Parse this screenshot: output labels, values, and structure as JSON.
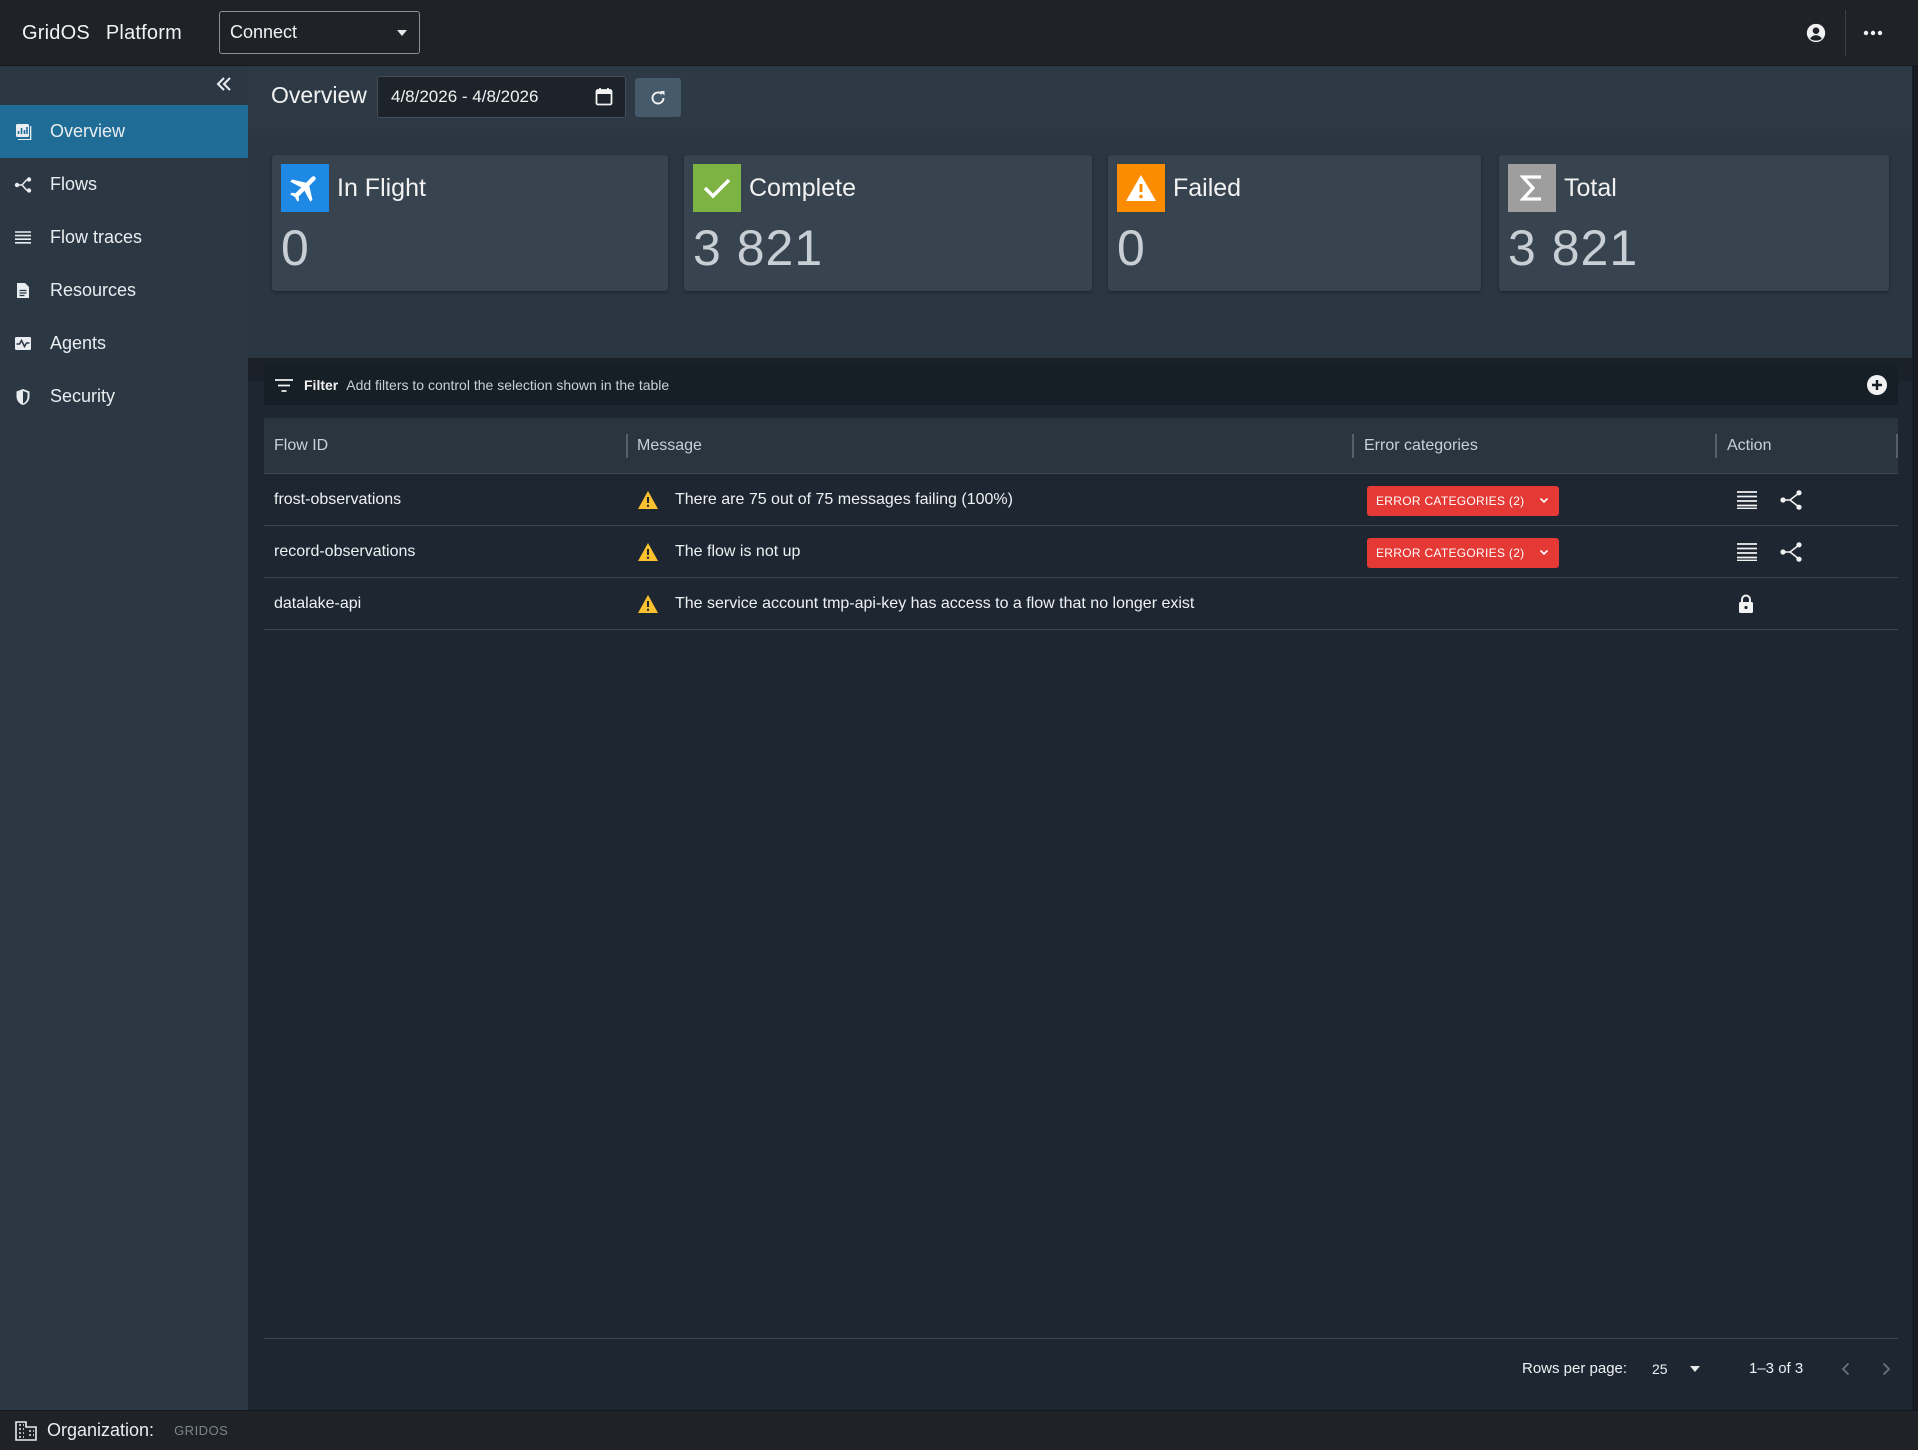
{
  "app": {
    "brand_name": "GridOS",
    "brand_suffix": "Platform",
    "app_selector_value": "Connect"
  },
  "sidebar": {
    "items": [
      {
        "label": "Overview",
        "icon": "overview-icon",
        "active": true
      },
      {
        "label": "Flows",
        "icon": "flows-icon",
        "active": false
      },
      {
        "label": "Flow traces",
        "icon": "list-icon",
        "active": false
      },
      {
        "label": "Resources",
        "icon": "document-icon",
        "active": false
      },
      {
        "label": "Agents",
        "icon": "monitor-icon",
        "active": false
      },
      {
        "label": "Security",
        "icon": "shield-icon",
        "active": false
      }
    ]
  },
  "header": {
    "title": "Overview",
    "date_range": "4/8/2026 - 4/8/2026"
  },
  "stats": [
    {
      "label": "In Flight",
      "value": "0",
      "icon": "airplane-icon",
      "color": "#1e88e5"
    },
    {
      "label": "Complete",
      "value": "3 821",
      "icon": "check-icon",
      "color": "#7cb342"
    },
    {
      "label": "Failed",
      "value": "0",
      "icon": "warning-icon",
      "color": "#fb8c00"
    },
    {
      "label": "Total",
      "value": "3 821",
      "icon": "sigma-icon",
      "color": "#9e9e9e"
    }
  ],
  "filter": {
    "title": "Filter",
    "hint": "Add filters to control the selection shown in the table"
  },
  "table": {
    "columns": [
      "Flow ID",
      "Message",
      "Error categories",
      "Action"
    ],
    "rows": [
      {
        "flow_id": "frost-observations",
        "message": "There are 75 out of 75 messages failing (100%)",
        "error_button": "ERROR CATEGORIES (2)"
      },
      {
        "flow_id": "record-observations",
        "message": "The flow is not up",
        "error_button": "ERROR CATEGORIES (2)"
      },
      {
        "flow_id": "datalake-api",
        "message": "The service account tmp-api-key has access to a flow that no longer exist",
        "error_button": ""
      }
    ]
  },
  "pagination": {
    "rows_per_page_label": "Rows per page:",
    "rows_per_page": "25",
    "range": "1–3 of 3"
  },
  "footer": {
    "org_label": "Organization:",
    "org_value": "GRIDOS"
  },
  "colors": {
    "accent": "#1f6d97",
    "error": "#e53935",
    "warning": "#fbc02d"
  }
}
